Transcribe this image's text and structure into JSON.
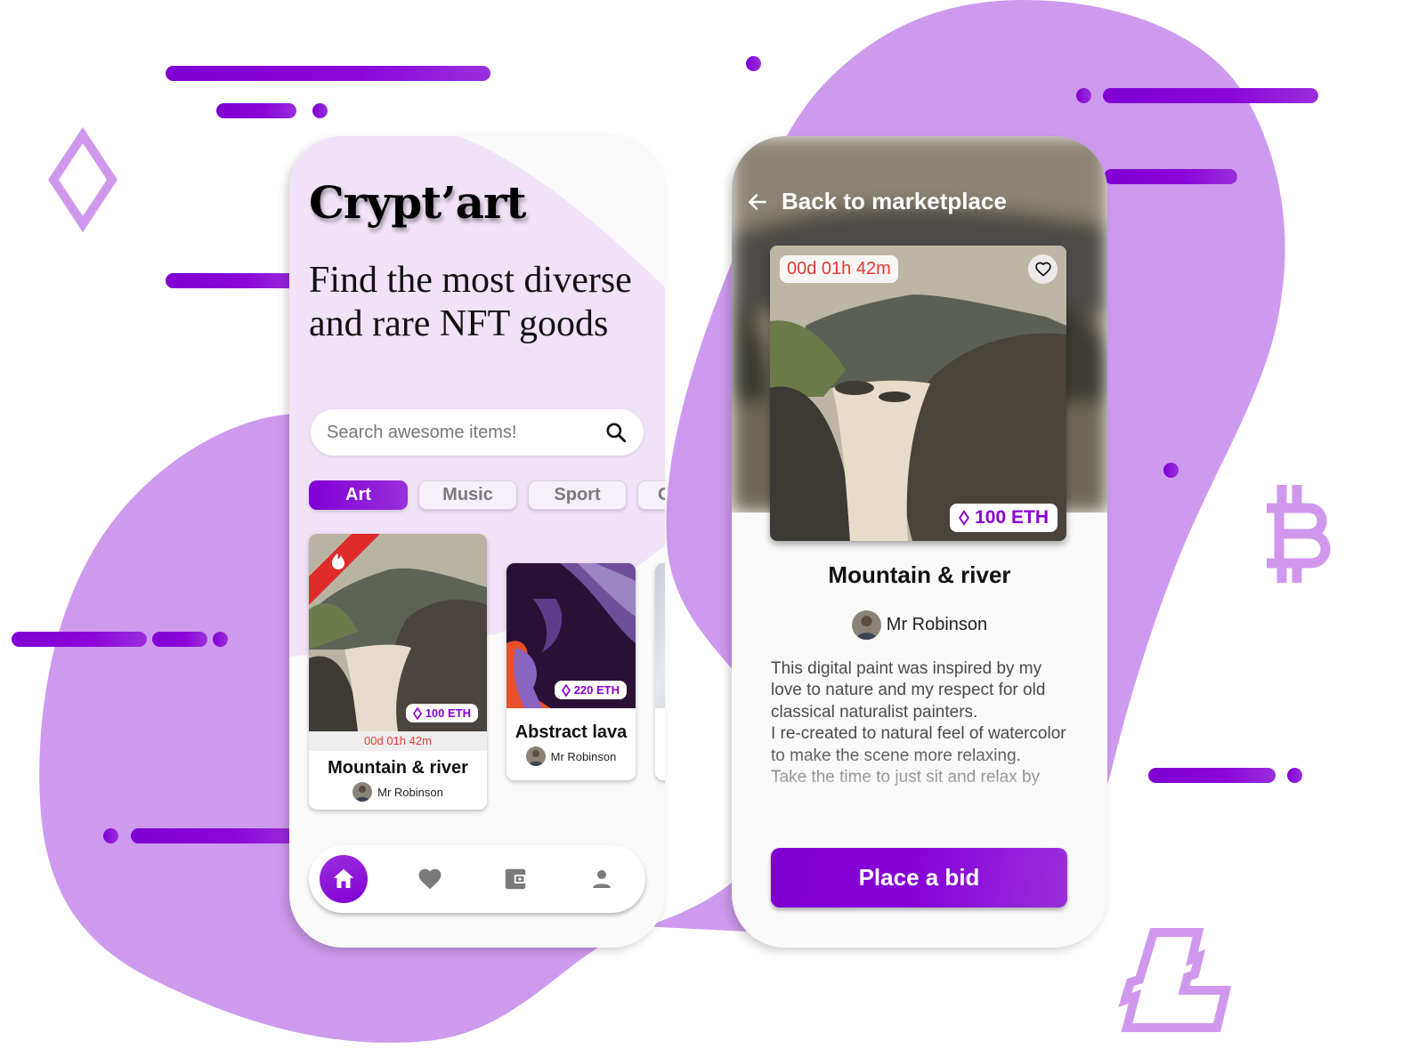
{
  "colors": {
    "brand_purple": "#8000d4",
    "brand_purple_light": "#9a2fdc",
    "blob_lilac": "#ce9aee",
    "hero_lavender": "#f0e2f7",
    "timer_red": "#e53935",
    "nav_gray": "#7a7a7a"
  },
  "decorations": {
    "icons": [
      "ethereum-diamond-icon",
      "bitcoin-icon",
      "litecoin-icon"
    ]
  },
  "marketplace_screen": {
    "brand": "Crypt’art",
    "headline": "Find the most diverse and rare NFT goods",
    "search": {
      "placeholder": "Search awesome items!",
      "value": "",
      "icon": "search-icon"
    },
    "categories": [
      {
        "label": "Art",
        "active": true
      },
      {
        "label": "Music",
        "active": false
      },
      {
        "label": "Sport",
        "active": false
      },
      {
        "label": "G",
        "active": false
      }
    ],
    "items": [
      {
        "title": "Mountain & river",
        "price": "100 ETH",
        "timer": "00d 01h 42m",
        "creator": "Mr Robinson",
        "hot": true,
        "hot_icon": "flame-icon"
      },
      {
        "title": "Abstract lava",
        "price": "220 ETH",
        "creator": "Mr Robinson",
        "hot": false
      },
      {
        "title": "",
        "price": "",
        "creator": "",
        "hot": false
      }
    ],
    "nav": [
      {
        "name": "home",
        "icon": "home-icon",
        "active": true
      },
      {
        "name": "favorites",
        "icon": "heart-icon",
        "active": false
      },
      {
        "name": "wallet",
        "icon": "wallet-icon",
        "active": false
      },
      {
        "name": "profile",
        "icon": "person-icon",
        "active": false
      }
    ]
  },
  "detail_screen": {
    "back_label": "Back to marketplace",
    "timer": "00d 01h 42m",
    "price": "100 ETH",
    "title": "Mountain & river",
    "creator": "Mr Robinson",
    "description": "This digital paint was inspired by my love to nature and my respect for old classical naturalist painters.\nI re-created to natural feel of watercolor to make the scene more relaxing.\nTake the time to just sit and relax by",
    "bid_button": "Place a bid"
  }
}
